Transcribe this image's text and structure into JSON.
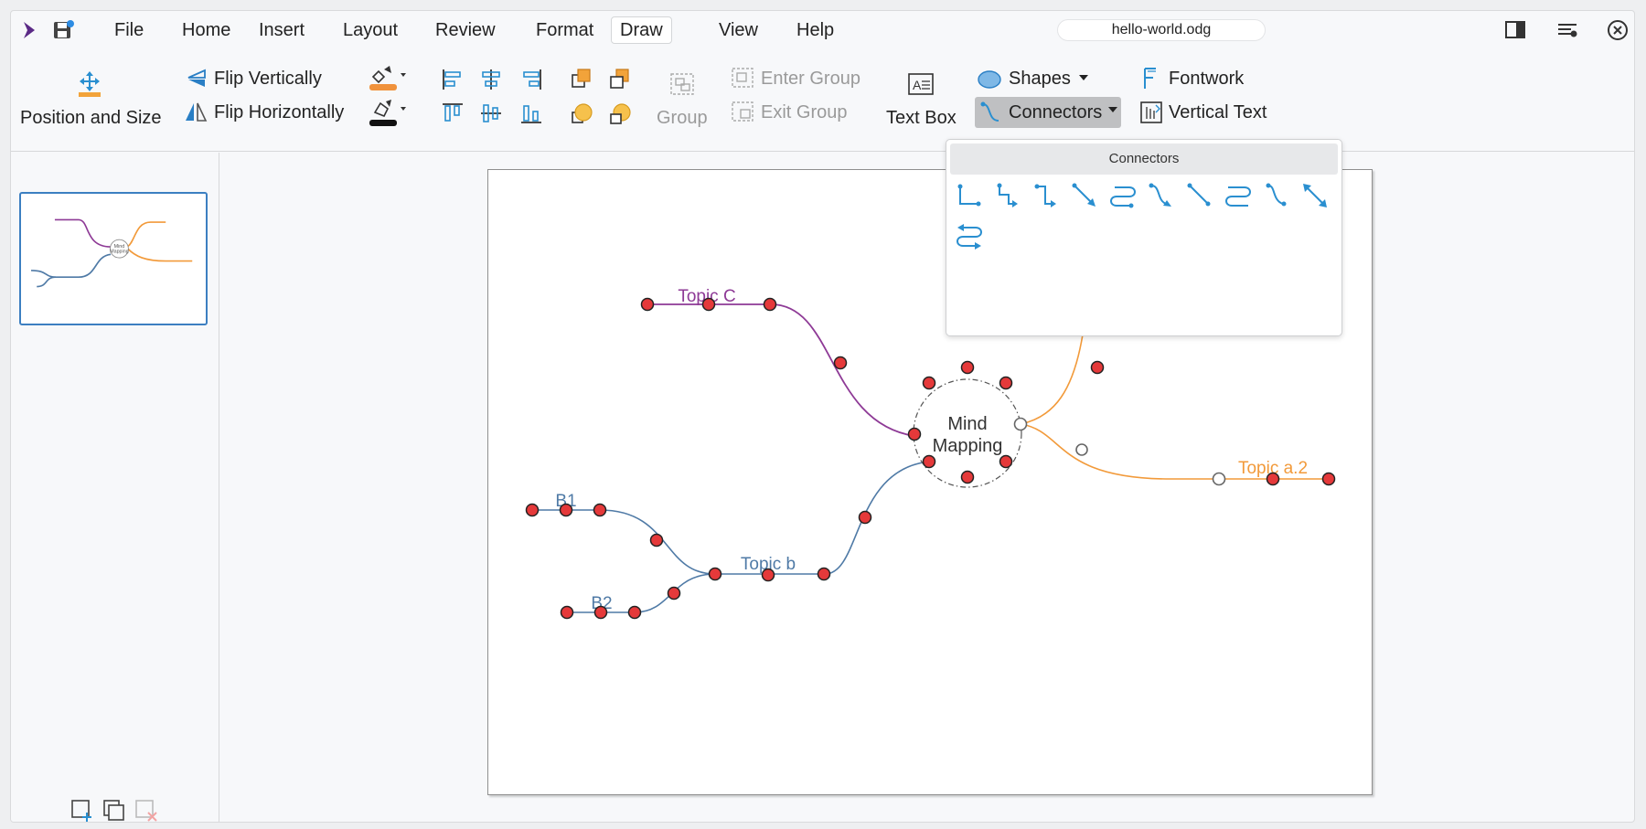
{
  "window": {
    "document_name": "hello-world.odg"
  },
  "menubar": {
    "items": [
      "File",
      "Home",
      "Insert",
      "Layout",
      "Review",
      "Format",
      "Draw",
      "View",
      "Help"
    ],
    "active": "Draw"
  },
  "ribbon": {
    "position_size": "Position and Size",
    "flip_vertically": "Flip Vertically",
    "flip_horizontally": "Flip Horizontally",
    "group": "Group",
    "enter_group": "Enter Group",
    "exit_group": "Exit Group",
    "text_box": "Text Box",
    "shapes": "Shapes",
    "connectors": "Connectors",
    "fontwork": "Fontwork",
    "vertical_text": "Vertical Text"
  },
  "popup": {
    "title": "Connectors",
    "items": [
      "connector-standard",
      "connector-standard-arrow-start",
      "connector-standard-arrow-end",
      "connector-line-arrows",
      "connector-curved",
      "connector-curved-arrow-end",
      "connector-line",
      "connector-curved-double",
      "connector-line-circle-end",
      "connector-straight-arrows",
      "connector-curved-arrows"
    ]
  },
  "canvas": {
    "center_label_line1": "Mind",
    "center_label_line2": "Mapping",
    "topic_c": "Topic C",
    "topic_b": "Topic b",
    "topic_a2": "Topic a.2",
    "b1": "B1",
    "b2": "B2"
  },
  "colors": {
    "accent": "#3c7fc1",
    "purple_branch": "#8e3a96",
    "orange_branch": "#f29a3a",
    "blue_branch": "#4f7aa6",
    "handle_fill": "#e5393a",
    "connector_icon": "#2a8fd0"
  }
}
